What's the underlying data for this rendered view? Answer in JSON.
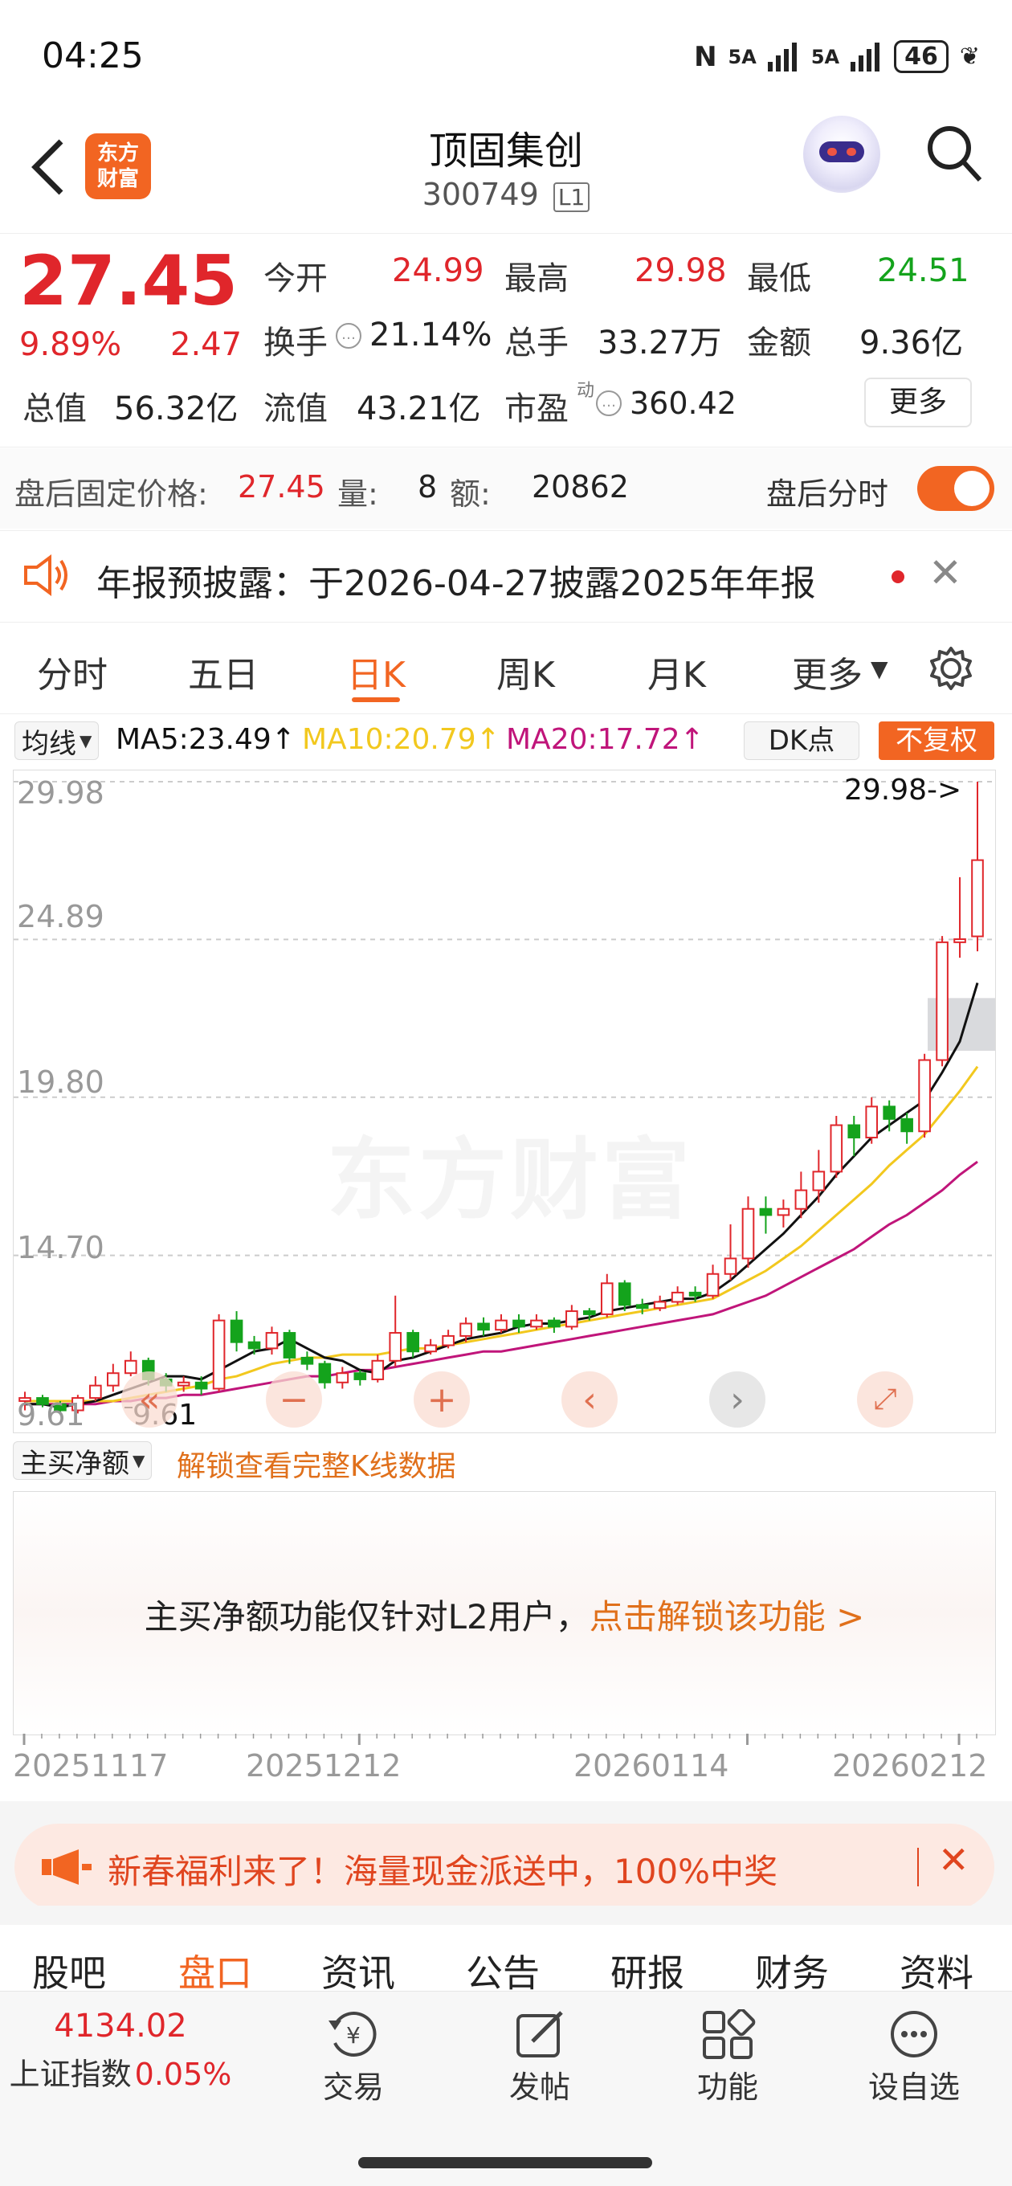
{
  "status_bar": {
    "time": "04:25",
    "battery": "46",
    "signal1": "5A",
    "signal2": "5A"
  },
  "header": {
    "title": "顶固集创",
    "code": "300749",
    "level_badge": "L1",
    "logo_line1": "东方",
    "logo_line2": "财富"
  },
  "quote": {
    "price": "27.45",
    "change_pct": "9.89%",
    "change": "2.47",
    "rows": [
      [
        {
          "label": "今开",
          "value": "24.99",
          "color": "red"
        },
        {
          "label": "最高",
          "value": "29.98",
          "color": "red"
        },
        {
          "label": "最低",
          "value": "24.51",
          "color": "green"
        }
      ],
      [
        {
          "label": "换手",
          "value": "21.14%",
          "color": "dark"
        },
        {
          "label": "总手",
          "value": "33.27万",
          "color": "dark"
        },
        {
          "label": "金额",
          "value": "9.36亿",
          "color": "dark"
        }
      ],
      [
        {
          "label": "总值",
          "value": "56.32亿",
          "color": "dark"
        },
        {
          "label": "流值",
          "value": "43.21亿",
          "color": "dark"
        },
        {
          "label": "市盈",
          "value": "360.42",
          "color": "dark"
        }
      ]
    ],
    "pe_superscript": "动",
    "more_button": "更多"
  },
  "after_hours": {
    "label": "盘后固定价格:",
    "price": "27.45",
    "vol_label": "量:",
    "vol": "8",
    "amt_label": "额:",
    "amt": "20862",
    "toggle_label": "盘后分时"
  },
  "notice": {
    "text": "年报预披露：于2026-04-27披露2025年年报"
  },
  "chart_tabs": [
    "分时",
    "五日",
    "日K",
    "周K",
    "月K",
    "更多"
  ],
  "active_tab": "日K",
  "ma_bar": {
    "selector": "均线",
    "ma5": "MA5:23.49↑",
    "ma10": "MA10:20.79↑",
    "ma20": "MA20:17.72↑",
    "dk_button": "DK点",
    "adjust_button": "不复权"
  },
  "y_labels": [
    "29.98",
    "24.89",
    "19.80",
    "14.70",
    "9.61"
  ],
  "high_marker": "29.98->",
  "low_marker": "9.61",
  "watermark": "东方财富",
  "sub_panel": {
    "selector": "主买净额",
    "unlock_link": "解锁查看完整K线数据",
    "message": "主买净额功能仅针对L2用户，",
    "message_link": "点击解锁该功能 >"
  },
  "x_labels": [
    "20251117",
    "20251212",
    "20260114",
    "20260212"
  ],
  "promo": {
    "text": "新春福利来了！海量现金派送中，100%中奖"
  },
  "section_tabs": [
    "股吧",
    "盘口",
    "资讯",
    "公告",
    "研报",
    "财务",
    "资料"
  ],
  "active_section": "盘口",
  "bottom_nav": {
    "index_value": "4134.02",
    "index_name": "上证指数",
    "index_change": "0.05%",
    "items": [
      "交易",
      "发帖",
      "功能",
      "设自选"
    ]
  },
  "colors": {
    "up": "#e0262b",
    "down": "#14a31c",
    "accent": "#f26522",
    "ma5": "#111111",
    "ma10": "#f2c81e",
    "ma20": "#c0157a"
  },
  "chart_data": {
    "type": "candlestick",
    "ylim": [
      9.61,
      29.98
    ],
    "y_ticks": [
      29.98,
      24.89,
      19.8,
      14.7,
      9.61
    ],
    "x_tick_labels": [
      "20251117",
      "20251212",
      "20260114",
      "20260212"
    ],
    "candles": [
      [
        10.0,
        10.1,
        9.7,
        10.3
      ],
      [
        10.1,
        9.9,
        9.8,
        10.2
      ],
      [
        9.9,
        9.7,
        9.61,
        10.0
      ],
      [
        9.7,
        10.1,
        9.6,
        10.2
      ],
      [
        10.1,
        10.5,
        10.0,
        10.8
      ],
      [
        10.5,
        10.9,
        10.3,
        11.2
      ],
      [
        10.9,
        11.3,
        10.8,
        11.6
      ],
      [
        11.3,
        10.7,
        10.5,
        11.4
      ],
      [
        10.7,
        10.5,
        10.3,
        10.9
      ],
      [
        10.5,
        10.6,
        10.3,
        10.8
      ],
      [
        10.6,
        10.4,
        10.2,
        10.8
      ],
      [
        10.4,
        12.6,
        10.3,
        12.8
      ],
      [
        12.6,
        11.9,
        11.6,
        12.9
      ],
      [
        11.9,
        11.7,
        11.5,
        12.1
      ],
      [
        11.7,
        12.2,
        11.5,
        12.4
      ],
      [
        12.2,
        11.4,
        11.2,
        12.3
      ],
      [
        11.4,
        11.2,
        11.0,
        11.6
      ],
      [
        11.2,
        10.6,
        10.4,
        11.3
      ],
      [
        10.6,
        10.9,
        10.4,
        11.1
      ],
      [
        10.9,
        10.7,
        10.5,
        11.0
      ],
      [
        10.7,
        11.3,
        10.6,
        11.5
      ],
      [
        11.3,
        12.2,
        11.1,
        13.4
      ],
      [
        12.2,
        11.6,
        11.4,
        12.3
      ],
      [
        11.6,
        11.8,
        11.5,
        12.0
      ],
      [
        11.8,
        12.1,
        11.7,
        12.3
      ],
      [
        12.1,
        12.5,
        11.9,
        12.7
      ],
      [
        12.5,
        12.3,
        12.1,
        12.7
      ],
      [
        12.3,
        12.6,
        12.2,
        12.8
      ],
      [
        12.6,
        12.4,
        12.2,
        12.8
      ],
      [
        12.4,
        12.6,
        12.3,
        12.8
      ],
      [
        12.6,
        12.4,
        12.2,
        12.7
      ],
      [
        12.4,
        12.9,
        12.3,
        13.1
      ],
      [
        12.9,
        12.8,
        12.6,
        13.0
      ],
      [
        12.8,
        13.8,
        12.7,
        14.1
      ],
      [
        13.8,
        13.1,
        12.9,
        13.9
      ],
      [
        13.1,
        13.0,
        12.8,
        13.3
      ],
      [
        13.0,
        13.2,
        12.9,
        13.4
      ],
      [
        13.2,
        13.5,
        13.1,
        13.7
      ],
      [
        13.5,
        13.4,
        13.2,
        13.7
      ],
      [
        13.4,
        14.1,
        13.3,
        14.4
      ],
      [
        14.1,
        14.6,
        13.9,
        15.7
      ],
      [
        14.6,
        16.2,
        14.3,
        16.6
      ],
      [
        16.2,
        16.0,
        15.4,
        16.6
      ],
      [
        16.0,
        16.2,
        15.6,
        16.5
      ],
      [
        16.2,
        16.8,
        15.9,
        17.4
      ],
      [
        16.8,
        17.4,
        16.4,
        18.1
      ],
      [
        17.4,
        18.9,
        17.2,
        19.2
      ],
      [
        18.9,
        18.5,
        17.9,
        19.2
      ],
      [
        18.5,
        19.5,
        18.3,
        19.8
      ],
      [
        19.5,
        19.1,
        18.7,
        19.7
      ],
      [
        19.1,
        18.7,
        18.3,
        19.3
      ],
      [
        18.7,
        21.0,
        18.5,
        21.2
      ],
      [
        21.0,
        24.8,
        20.8,
        25.0
      ],
      [
        24.8,
        24.9,
        24.3,
        26.9
      ],
      [
        24.99,
        27.45,
        24.51,
        29.98
      ]
    ],
    "ma5": [
      9.9,
      9.9,
      9.8,
      9.9,
      10.0,
      10.2,
      10.4,
      10.6,
      10.8,
      10.8,
      10.7,
      11.0,
      11.3,
      11.6,
      11.7,
      12.0,
      11.7,
      11.4,
      11.3,
      11.0,
      10.9,
      11.3,
      11.4,
      11.6,
      11.8,
      12.0,
      12.1,
      12.2,
      12.4,
      12.5,
      12.5,
      12.6,
      12.7,
      12.9,
      13.0,
      13.1,
      13.2,
      13.3,
      13.3,
      13.5,
      13.9,
      14.4,
      14.9,
      15.4,
      16.0,
      16.6,
      17.3,
      17.9,
      18.5,
      18.9,
      19.3,
      19.7,
      20.6,
      21.6,
      23.49
    ],
    "ma10": [
      10.0,
      10.0,
      10.0,
      10.0,
      10.0,
      10.0,
      10.1,
      10.2,
      10.3,
      10.4,
      10.5,
      10.7,
      10.8,
      11.0,
      11.2,
      11.3,
      11.4,
      11.4,
      11.5,
      11.5,
      11.5,
      11.6,
      11.7,
      11.7,
      11.8,
      11.9,
      12.0,
      12.1,
      12.2,
      12.3,
      12.4,
      12.5,
      12.6,
      12.7,
      12.8,
      12.9,
      13.0,
      13.1,
      13.2,
      13.3,
      13.6,
      13.9,
      14.2,
      14.6,
      15.0,
      15.5,
      16.0,
      16.5,
      17.0,
      17.6,
      18.1,
      18.6,
      19.3,
      20.0,
      20.79
    ],
    "ma20": [
      9.9,
      9.9,
      9.9,
      9.9,
      9.9,
      10.0,
      10.0,
      10.1,
      10.1,
      10.2,
      10.2,
      10.3,
      10.4,
      10.5,
      10.6,
      10.7,
      10.8,
      10.8,
      10.9,
      11.0,
      11.0,
      11.1,
      11.2,
      11.3,
      11.4,
      11.5,
      11.6,
      11.6,
      11.7,
      11.8,
      11.9,
      12.0,
      12.1,
      12.2,
      12.3,
      12.4,
      12.5,
      12.6,
      12.7,
      12.8,
      13.0,
      13.2,
      13.4,
      13.7,
      14.0,
      14.3,
      14.6,
      14.9,
      15.3,
      15.7,
      16.0,
      16.4,
      16.8,
      17.3,
      17.72
    ]
  }
}
